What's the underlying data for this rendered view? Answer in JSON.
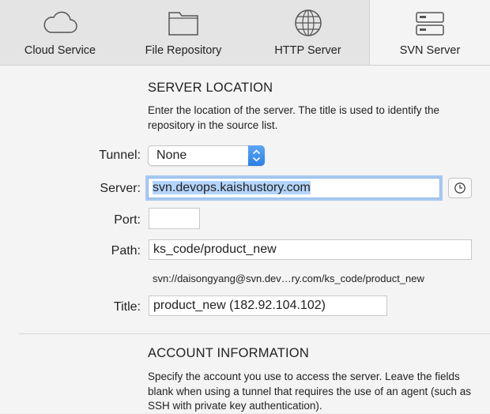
{
  "toolbar": {
    "tabs": [
      {
        "label": "Cloud Service",
        "icon": "cloud-icon",
        "selected": false
      },
      {
        "label": "File Repository",
        "icon": "folder-icon",
        "selected": false
      },
      {
        "label": "HTTP Server",
        "icon": "globe-icon",
        "selected": false
      },
      {
        "label": "SVN Server",
        "icon": "server-icon",
        "selected": true
      }
    ]
  },
  "server_location": {
    "heading": "SERVER LOCATION",
    "description": "Enter the location of the server. The title is used to identify the repository in the source list.",
    "tunnel": {
      "label": "Tunnel:",
      "value": "None"
    },
    "server": {
      "label": "Server:",
      "value": "svn.devops.kaishustory.com"
    },
    "port": {
      "label": "Port:",
      "value": ""
    },
    "path": {
      "label": "Path:",
      "value": "ks_code/product_new"
    },
    "resolved_url": "svn://daisongyang@svn.dev…ry.com/ks_code/product_new",
    "title": {
      "label": "Title:",
      "value": "product_new (182.92.104.102)"
    }
  },
  "account_information": {
    "heading": "ACCOUNT INFORMATION",
    "description": "Specify the account you use to access the server. Leave the fields blank when using a tunnel that requires the use of an agent (such as SSH with private key authentication)."
  },
  "colors": {
    "accent": "#2a7fe8",
    "focus_ring": "#a9c9f0",
    "selection": "#b3d4fc"
  }
}
